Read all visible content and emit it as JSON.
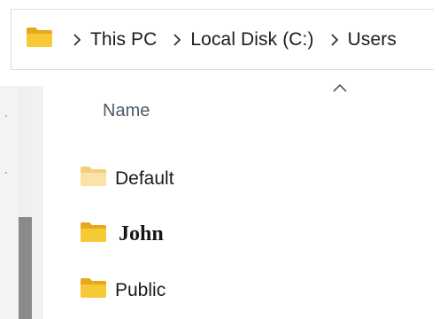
{
  "breadcrumb": {
    "items": [
      {
        "label": "This PC"
      },
      {
        "label": "Local Disk (C:)"
      },
      {
        "label": "Users"
      }
    ]
  },
  "file_list": {
    "column_header": "Name",
    "sort_direction": "ascending",
    "items": [
      {
        "label": "Default",
        "icon": "folder-light-icon",
        "style": "normal"
      },
      {
        "label": "John",
        "icon": "folder-icon",
        "style": "serif-bold"
      },
      {
        "label": "Public",
        "icon": "folder-icon",
        "style": "normal"
      }
    ]
  },
  "colors": {
    "folder_yellow": "#f8c937",
    "folder_light": "#f9e3a6",
    "scroll_thumb": "#8a8a8a"
  }
}
